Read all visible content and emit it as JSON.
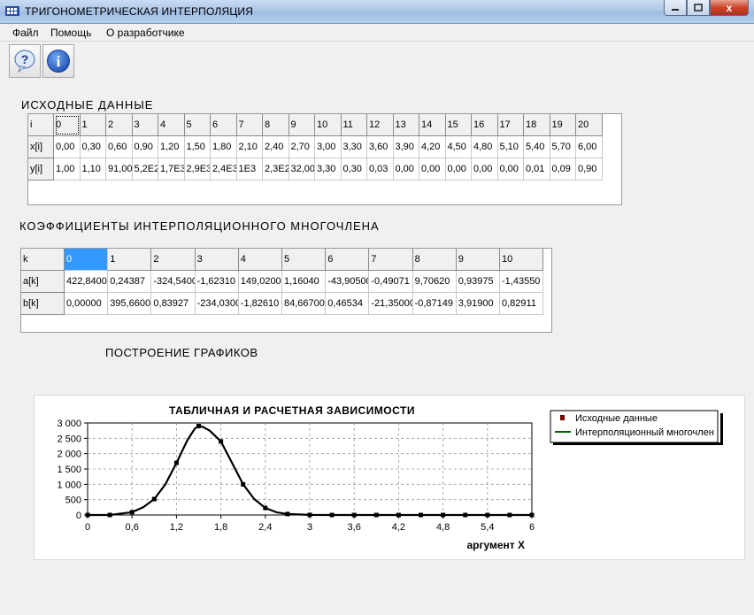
{
  "window": {
    "title": "ТРИГОНОМЕТРИЧЕСКАЯ  ИНТЕРПОЛЯЦИЯ",
    "close_glyph": "x"
  },
  "menu": [
    "Файл",
    "Помощь",
    "О разработчике"
  ],
  "toolbar": {
    "help_icon": "help-balloon-icon",
    "info_icon": "info-icon",
    "help_glyph": "?",
    "info_glyph": "i"
  },
  "source_section": {
    "title": "ИСХОДНЫЕ  ДАННЫЕ",
    "row_headers": [
      "i",
      "x[i]",
      "y[i]"
    ],
    "i": [
      "0",
      "1",
      "2",
      "3",
      "4",
      "5",
      "6",
      "7",
      "8",
      "9",
      "10",
      "11",
      "12",
      "13",
      "14",
      "15",
      "16",
      "17",
      "18",
      "19",
      "20"
    ],
    "x": [
      "0,00",
      "0,30",
      "0,60",
      "0,90",
      "1,20",
      "1,50",
      "1,80",
      "2,10",
      "2,40",
      "2,70",
      "3,00",
      "3,30",
      "3,60",
      "3,90",
      "4,20",
      "4,50",
      "4,80",
      "5,10",
      "5,40",
      "5,70",
      "6,00"
    ],
    "y": [
      "1,00",
      "1,10",
      "91,00",
      "5,2E2",
      "1,7E3",
      "2,9E3",
      "2,4E3",
      "1E3",
      "2,3E2",
      "32,00",
      "3,30",
      "0,30",
      "0,03",
      "0,00",
      "0,00",
      "0,00",
      "0,00",
      "0,00",
      "0,01",
      "0,09",
      "0,90"
    ]
  },
  "coef_section": {
    "title": "КОЭФФИЦИЕНТЫ  ИНТЕРПОЛЯЦИОННОГО  МНОГОЧЛЕНА",
    "row_headers": [
      "k",
      "a[k]",
      "b[k]"
    ],
    "k": [
      "0",
      "1",
      "2",
      "3",
      "4",
      "5",
      "6",
      "7",
      "8",
      "9",
      "10"
    ],
    "a": [
      "422,8400",
      "0,24387",
      "-324,5400",
      "-1,62310",
      "149,0200",
      "1,16040",
      "-43,90500",
      "-0,49071",
      "9,70620",
      "0,93975",
      "-1,43550"
    ],
    "b": [
      "0,00000",
      "395,6600",
      "0,83927",
      "-234,0300",
      "-1,82610",
      "84,66700",
      "0,46534",
      "-21,35000",
      "-0,87149",
      "3,91900",
      "0,82911"
    ]
  },
  "plot_section": {
    "title": "ПОСТРОЕНИЕ ГРАФИКОВ"
  },
  "colors": {
    "marker": "#7a0000",
    "line_interp": "#006400",
    "line_table": "#000000",
    "selection": "#3399ff"
  },
  "chart_data": {
    "type": "line",
    "title": "ТАБЛИЧНАЯ  И  РАСЧЕТНАЯ  ЗАВИСИМОСТИ",
    "xlabel": "аргумент X",
    "ylabel": "",
    "xlim": [
      0,
      6
    ],
    "ylim": [
      0,
      3000
    ],
    "x_ticks": [
      "0",
      "0,6",
      "1,2",
      "1,8",
      "2,4",
      "3",
      "3,6",
      "4,2",
      "4,8",
      "5,4",
      "6"
    ],
    "y_ticks": [
      "0",
      "500",
      "1 000",
      "1 500",
      "2 000",
      "2 500",
      "3 000"
    ],
    "grid": true,
    "legend_position": "top-right",
    "series": [
      {
        "name": "Исходные данные",
        "style": "markers",
        "x": [
          0,
          0.3,
          0.6,
          0.9,
          1.2,
          1.5,
          1.8,
          2.1,
          2.4,
          2.7,
          3.0,
          3.3,
          3.6,
          3.9,
          4.2,
          4.5,
          4.8,
          5.1,
          5.4,
          5.7,
          6.0
        ],
        "y": [
          1,
          1.1,
          91,
          520,
          1700,
          2900,
          2400,
          1000,
          230,
          32,
          3.3,
          0.3,
          0.03,
          0,
          0,
          0,
          0,
          0,
          0.01,
          0.09,
          0.9
        ]
      },
      {
        "name": "Интерполяционный многочлен",
        "style": "line",
        "x": [
          0,
          0.3,
          0.6,
          0.75,
          0.9,
          1.05,
          1.2,
          1.35,
          1.45,
          1.5,
          1.55,
          1.65,
          1.8,
          1.95,
          2.1,
          2.25,
          2.4,
          2.55,
          2.7,
          3.0,
          3.3,
          3.6,
          3.9,
          4.2,
          4.5,
          4.8,
          5.1,
          5.4,
          5.7,
          6.0
        ],
        "y": [
          1,
          1.1,
          91,
          250,
          520,
          1000,
          1700,
          2450,
          2820,
          2900,
          2880,
          2750,
          2400,
          1700,
          1000,
          520,
          230,
          90,
          32,
          3.3,
          0.3,
          0.03,
          0,
          0,
          0,
          0,
          0,
          0.01,
          0.09,
          0.9
        ]
      }
    ]
  }
}
